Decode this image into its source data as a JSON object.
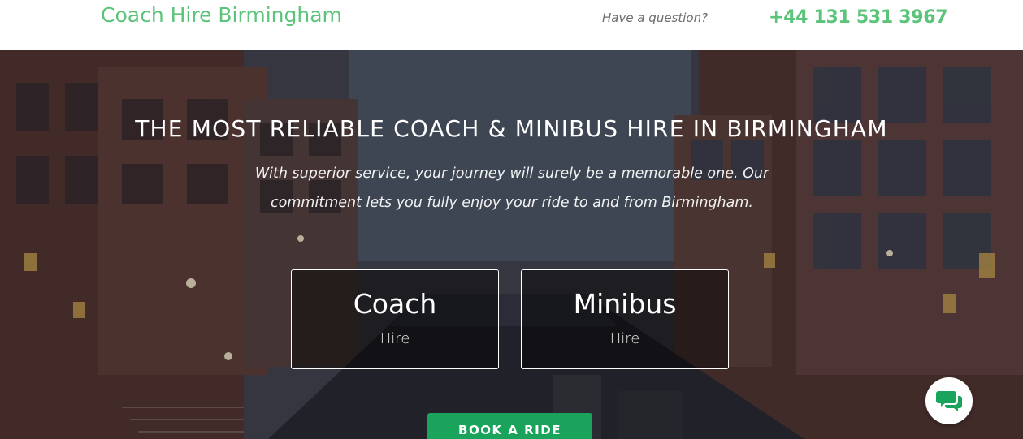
{
  "header": {
    "brand": "Coach Hire Birmingham",
    "question": "Have a question?",
    "phone": "+44 131 531 3967"
  },
  "hero": {
    "headline": "THE MOST RELIABLE COACH & MINIBUS HIRE IN BIRMINGHAM",
    "tagline": "With superior service, your journey will surely be a memorable one. Our commitment lets you fully enjoy your ride to and from Birmingham.",
    "cards": [
      {
        "title": "Coach",
        "subtitle": "Hire"
      },
      {
        "title": "Minibus",
        "subtitle": "Hire"
      }
    ],
    "cta": "BOOK A RIDE"
  },
  "chat": {
    "icon": "chat-bubbles-icon"
  },
  "colors": {
    "brand_green": "#5cc47a",
    "button_green": "#1aa35a"
  }
}
